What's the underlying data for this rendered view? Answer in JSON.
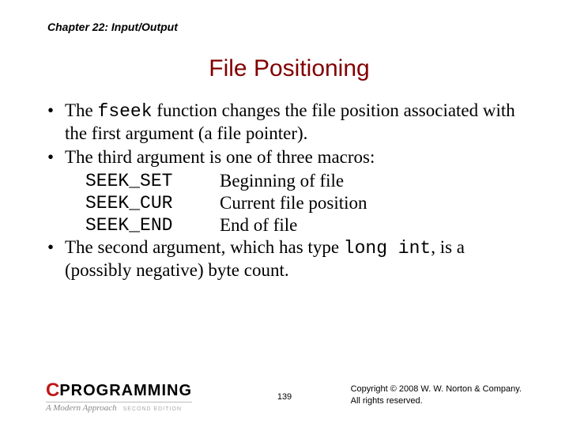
{
  "chapter": "Chapter 22: Input/Output",
  "title": "File Positioning",
  "bullets": [
    {
      "pre": "The ",
      "code": "fseek",
      "post": " function changes the file position associated with the first argument (a file pointer)."
    },
    {
      "text": "The third argument is one of three macros:"
    },
    {
      "pre": "The second argument, which has type ",
      "code": "long int",
      "post": ", is a (possibly negative) byte count."
    }
  ],
  "macros": [
    {
      "name": "SEEK_SET",
      "desc": "Beginning of file"
    },
    {
      "name": "SEEK_CUR",
      "desc": "Current file position"
    },
    {
      "name": "SEEK_END",
      "desc": "End of file"
    }
  ],
  "logo": {
    "c": "C",
    "prog": "PROGRAMMING",
    "sub": "A Modern Approach",
    "edition": "SECOND EDITION"
  },
  "page_number": "139",
  "copyright_line1": "Copyright © 2008 W. W. Norton & Company.",
  "copyright_line2": "All rights reserved."
}
